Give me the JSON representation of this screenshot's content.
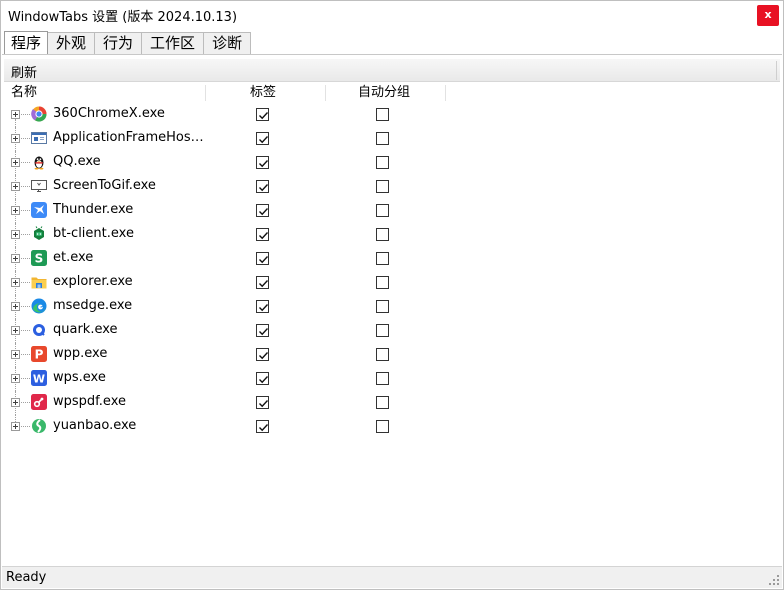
{
  "window": {
    "title": "WindowTabs 设置 (版本 2024.10.13)",
    "close_label": "x"
  },
  "tabs": [
    {
      "label": "程序",
      "active": true
    },
    {
      "label": "外观",
      "active": false
    },
    {
      "label": "行为",
      "active": false
    },
    {
      "label": "工作区",
      "active": false
    },
    {
      "label": "诊断",
      "active": false
    }
  ],
  "toolbar": {
    "refresh_label": "刷新"
  },
  "columns": {
    "name": "名称",
    "tabs": "标签",
    "auto_group": "自动分组"
  },
  "apps": [
    {
      "name": "360ChromeX.exe",
      "icon": "chrome-360-icon",
      "tab": true,
      "group": false
    },
    {
      "name": "ApplicationFrameHost.exe",
      "icon": "app-frame-icon",
      "tab": true,
      "group": false
    },
    {
      "name": "QQ.exe",
      "icon": "qq-penguin-icon",
      "tab": true,
      "group": false
    },
    {
      "name": "ScreenToGif.exe",
      "icon": "monitor-icon",
      "tab": true,
      "group": false
    },
    {
      "name": "Thunder.exe",
      "icon": "thunder-bird-icon",
      "tab": true,
      "group": false
    },
    {
      "name": "bt-client.exe",
      "icon": "bt-robot-icon",
      "tab": true,
      "group": false
    },
    {
      "name": "et.exe",
      "icon": "spreadsheet-s-icon",
      "tab": true,
      "group": false
    },
    {
      "name": "explorer.exe",
      "icon": "folder-icon",
      "tab": true,
      "group": false
    },
    {
      "name": "msedge.exe",
      "icon": "edge-icon",
      "tab": true,
      "group": false
    },
    {
      "name": "quark.exe",
      "icon": "quark-icon",
      "tab": true,
      "group": false
    },
    {
      "name": "wpp.exe",
      "icon": "presentation-p-icon",
      "tab": true,
      "group": false
    },
    {
      "name": "wps.exe",
      "icon": "writer-w-icon",
      "tab": true,
      "group": false
    },
    {
      "name": "wpspdf.exe",
      "icon": "pdf-icon",
      "tab": true,
      "group": false
    },
    {
      "name": "yuanbao.exe",
      "icon": "yuanbao-icon",
      "tab": true,
      "group": false
    }
  ],
  "status": {
    "text": "Ready"
  }
}
